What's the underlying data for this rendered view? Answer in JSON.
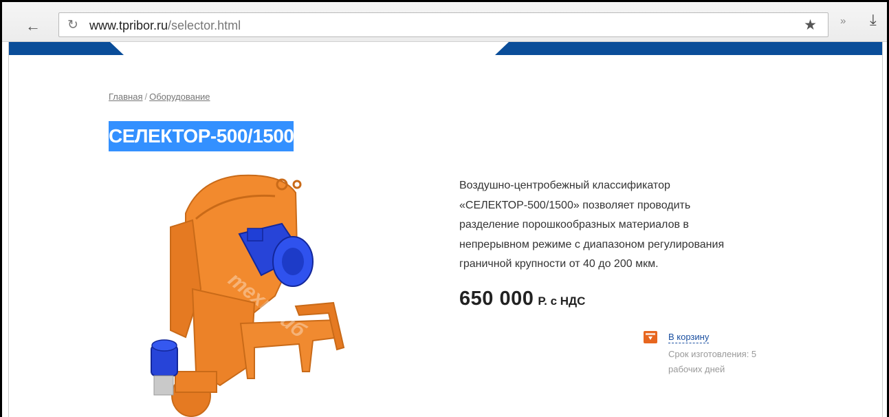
{
  "browser": {
    "url_host": "www.tpribor.ru",
    "url_path": "/selector.html",
    "icons": {
      "back": "arrow-left-icon",
      "reload": "reload-icon",
      "bookmark": "star-icon",
      "extensions": "double-chevron-icon",
      "download": "download-icon"
    }
  },
  "colors": {
    "header_blue": "#0a4d99",
    "selection_blue": "#3390ff",
    "cart_orange": "#e7661f",
    "machine_orange": "#f28a2e",
    "motor_blue": "#1f3fd6",
    "link_blue": "#1a4fa0"
  },
  "breadcrumb": {
    "items": [
      "Главная",
      "Оборудование"
    ],
    "separator": "/"
  },
  "product": {
    "title": "СЕЛЕКТОР-500/1500",
    "description_lines": [
      "Воздушно-центробежный классификатор",
      "«СЕЛЕКТОР-500/1500» позволяет проводить",
      "разделение порошкообразных материалов в",
      "непрерывном режиме с диапазоном регулирования",
      "граничной крупности от 40 до 200 мкм."
    ],
    "price_value": "650 000",
    "price_unit": "Р. с НДС",
    "cart_label": "В корзину",
    "lead_time": "Срок изготовления: 5 рабочих дней",
    "watermark": "техприб"
  }
}
